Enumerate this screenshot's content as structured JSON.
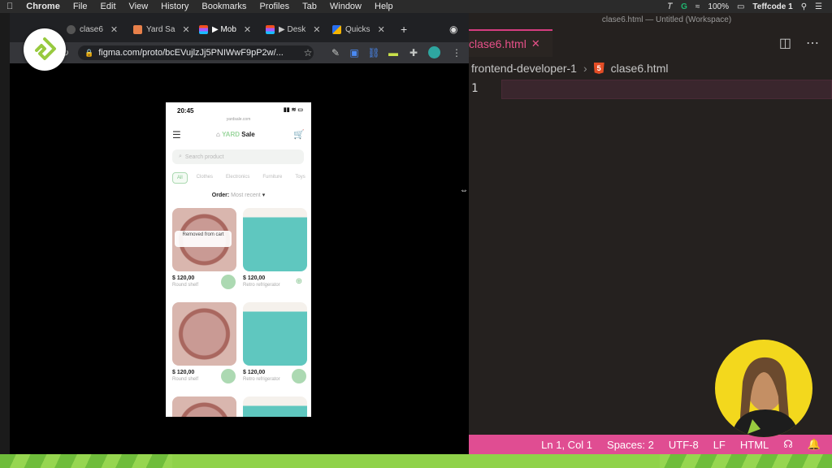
{
  "menubar": {
    "items": [
      "Chrome",
      "File",
      "Edit",
      "View",
      "History",
      "Bookmarks",
      "Profiles",
      "Tab",
      "Window",
      "Help"
    ],
    "battery": "100%",
    "user": "Teffcode 1"
  },
  "browser": {
    "tabs": [
      {
        "label": "clase6"
      },
      {
        "label": "Yard Sa"
      },
      {
        "label": "▶ Mob"
      },
      {
        "label": "▶ Desk"
      },
      {
        "label": "Quicks"
      }
    ],
    "new_tab": "+",
    "url": "figma.com/proto/bcEVujlzJj5PNIWwF9pP2w/..."
  },
  "prototype": {
    "time": "20:45",
    "site": "yardsale.com",
    "brand_prefix": "YARD",
    "brand_suffix": "Sale",
    "search_placeholder": "Search product",
    "categories": [
      "All",
      "Clothes",
      "Electronics",
      "Furniture",
      "Toys"
    ],
    "order_label": "Order:",
    "order_value": "Most recent",
    "removed_toast": "Removed from cart",
    "products": [
      {
        "price": "$ 120,00",
        "name": "Round shelf"
      },
      {
        "price": "$ 120,00",
        "name": "Retro refrigerator"
      },
      {
        "price": "$ 120,00",
        "name": "Round shelf"
      },
      {
        "price": "$ 120,00",
        "name": "Retro refrigerator"
      }
    ]
  },
  "editor": {
    "window_title": "clase6.html — Untitled (Workspace)",
    "tab_label": "clase6.html",
    "breadcrumb_folder": "frontend-developer-1",
    "breadcrumb_file": "clase6.html",
    "line_number": "1",
    "status": {
      "position": "Ln 1, Col 1",
      "spaces": "Spaces: 2",
      "encoding": "UTF-8",
      "eol": "LF",
      "language": "HTML"
    }
  },
  "colors": {
    "accent_pink": "#e04d92",
    "prototype_green": "#acd9b2",
    "brand_green": "#8fd249"
  }
}
